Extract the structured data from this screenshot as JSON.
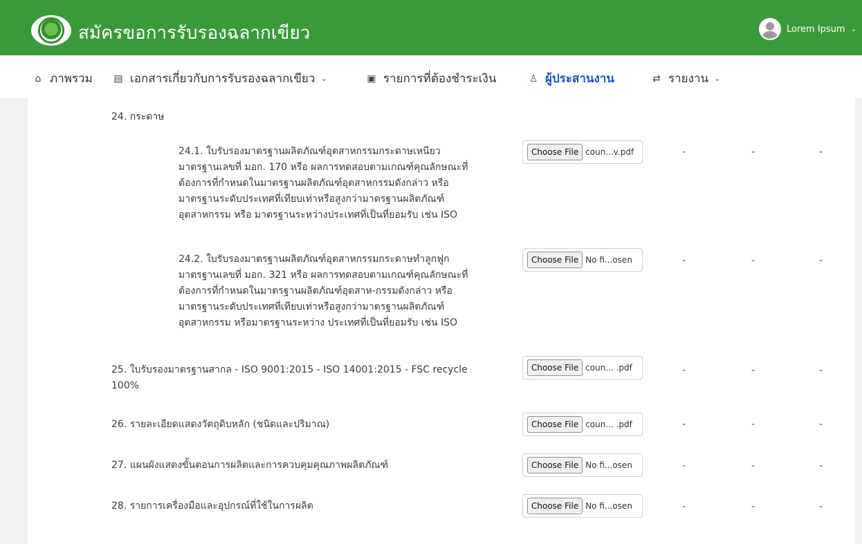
{
  "header": {
    "title": "สมัครขอการรับรองฉลากเขียว",
    "user_name": "Lorem Ipsum",
    "user_chevron": "⌄",
    "logo_icon": "green-label-logo",
    "colors": {
      "header_bg": "#3a9a3a",
      "active_nav": "#1f4fd1"
    }
  },
  "nav": {
    "overview": {
      "label": "ภาพรวม",
      "icon": "home-icon",
      "glyph": "⌂"
    },
    "documents": {
      "label": "เอกสารเกี่ยวกับการรับรองฉลากเขียว",
      "icon": "document-icon",
      "glyph": "▤",
      "chevron": "⌄"
    },
    "payments": {
      "label": "รายการที่ต้องชำระเงิน",
      "icon": "payment-icon",
      "glyph": "▣"
    },
    "coordinator": {
      "label": "ผู้ประสานงาน",
      "icon": "user-icon",
      "glyph": "♙"
    },
    "reports": {
      "label": "รายงาน",
      "icon": "swap-icon",
      "glyph": "⇄",
      "chevron": "⌄"
    }
  },
  "main": {
    "section_title": "24. กระดาษ",
    "choose_file_label": "Choose File",
    "dash": "-",
    "items": [
      {
        "lines": [
          "24.1. ใบรับรองมาตรฐานผลิตภัณฑ์อุตสาหกรรมกระดาษเหนียว",
          "มาตรฐานเลขที่ มอก. 170 หรือ ผลการทดสอบตามเกณฑ์คุณลักษณะที่",
          "ต้องการที่กำหนดในมาตรฐานผลิตภัณฑ์อุตสาหกรรมดังกล่าว หรือ",
          "มาตรฐานระดับประเทศที่เทียบเท่าหรือสูงกว่ามาตรฐานผลิตภัณฑ์",
          "อุตสาหกรรม หรือ มาตรฐานระหว่างประเทศที่เป็นที่ยอมรับ เช่น ISO"
        ],
        "file_name": "coun...v.pdf"
      },
      {
        "lines": [
          "24.2. ใบรับรองมาตรฐานผลิตภัณฑ์อุตสาหกรรมกระดาษทำลูกฟูก",
          "มาตรฐานเลขที่ มอก. 321 หรือ ผลการทดสอบตามเกณฑ์คุณลักษณะที่",
          "ต้องการที่กำหนดในมาตรฐานผลิตภัณฑ์อุตสาห-กรรมดังกล่าว หรือ",
          "มาตรฐานระดับประเทศที่เทียบเท่าหรือสูงกว่ามาตรฐานผลิตภัณฑ์",
          "อุตสาหกรรม หรือมาตรฐานระหว่าง ประเทศที่เป็นที่ยอมรับ เช่น ISO"
        ],
        "file_name": "No fi...osen"
      },
      {
        "lines": [
          "25. ใบรับรองมาตรฐานสากล - ISO 9001:2015 - ISO 14001:2015 - FSC recycle",
          "100%"
        ],
        "file_name": "coun... .pdf"
      },
      {
        "lines": [
          "26. รายละเอียดแสดงวัตถุดิบหลัก (ชนิดและปริมาณ)"
        ],
        "file_name": "coun... .pdf"
      },
      {
        "lines": [
          "27. แผนผังแสดงขั้นตอนการผลิตและการควบคุมคุณภาพผลิตภัณฑ์"
        ],
        "file_name": "No fi...osen"
      },
      {
        "lines": [
          "28. รายการเครื่องมือและอุปกรณ์ที่ใช้ในการผลิต"
        ],
        "file_name": "No fi...osen"
      }
    ]
  }
}
